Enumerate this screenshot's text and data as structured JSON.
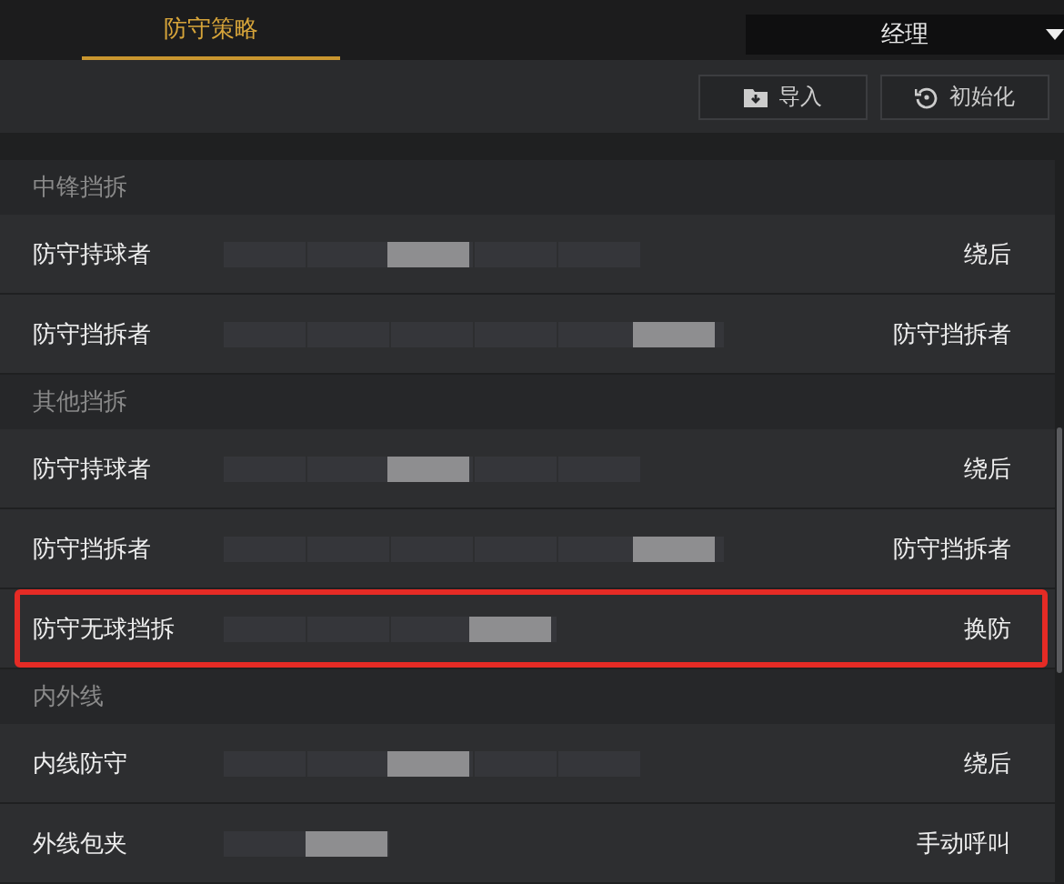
{
  "tabs": [
    {
      "label": "防守策略",
      "selected": true
    }
  ],
  "role_select": {
    "value": "经理"
  },
  "toolbar": {
    "buttons": [
      {
        "label": "导入",
        "kind": "import"
      },
      {
        "label": "初始化",
        "kind": "reset"
      }
    ]
  },
  "sections": [
    {
      "title": "中锋挡拆",
      "rows": [
        {
          "label": "防守持球者",
          "kind": "medium",
          "level": 0.5,
          "value": "绕后",
          "highlighted": false
        },
        {
          "label": "防守挡拆者",
          "kind": "long",
          "level": 1,
          "value": "防守挡拆者",
          "highlighted": false
        }
      ]
    },
    {
      "title": "其他挡拆",
      "rows": [
        {
          "label": "防守持球者",
          "kind": "medium",
          "level": 0.5,
          "value": "绕后",
          "highlighted": false
        },
        {
          "label": "防守挡拆者",
          "kind": "long",
          "level": 1,
          "value": "防守挡拆者",
          "highlighted": false
        },
        {
          "label": "防守无球挡拆",
          "kind": "compact",
          "level": 1,
          "value": "换防",
          "highlighted": true
        }
      ]
    },
    {
      "title": "内外线",
      "rows": [
        {
          "label": "内线防守",
          "kind": "medium",
          "level": 0.5,
          "value": "绕后",
          "highlighted": false
        },
        {
          "label": "外线包夹",
          "kind": "short",
          "level": 1,
          "value": "手动呼叫",
          "highlighted": false
        }
      ]
    }
  ]
}
